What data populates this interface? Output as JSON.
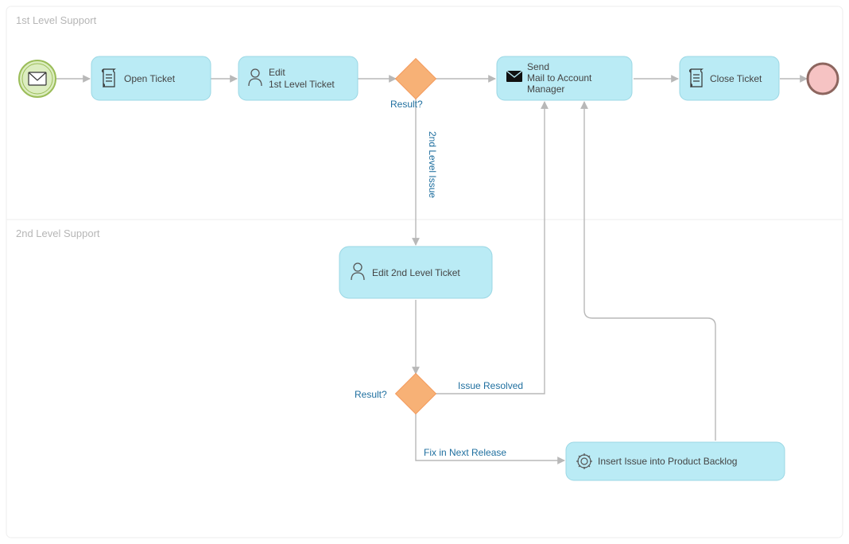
{
  "lanes": {
    "lane1": "1st Level Support",
    "lane2": "2nd Level Support"
  },
  "tasks": {
    "open_ticket": "Open Ticket",
    "edit1_line1": "Edit",
    "edit1_line2": "1st Level Ticket",
    "edit2": "Edit 2nd Level Ticket",
    "send1": "Send",
    "send2": "Mail to Account",
    "send3": "Manager",
    "close": "Close Ticket",
    "insert": "Insert Issue into Product Backlog"
  },
  "gateways": {
    "g1_label": "Result?",
    "g2_label": "Result?"
  },
  "flows": {
    "second_level": "2nd Level Issue",
    "issue_resolved": "Issue Resolved",
    "fix_next": "Fix in Next Release"
  },
  "chart_data": {
    "type": "bpmn",
    "lanes": [
      {
        "id": "L1",
        "name": "1st Level Support"
      },
      {
        "id": "L2",
        "name": "2nd Level Support"
      }
    ],
    "nodes": [
      {
        "id": "start",
        "type": "messageStartEvent",
        "lane": "L1",
        "label": ""
      },
      {
        "id": "t_open",
        "type": "scriptTask",
        "lane": "L1",
        "label": "Open Ticket"
      },
      {
        "id": "t_edit1",
        "type": "userTask",
        "lane": "L1",
        "label": "Edit 1st Level Ticket"
      },
      {
        "id": "g1",
        "type": "exclusiveGateway",
        "lane": "L1",
        "label": "Result?"
      },
      {
        "id": "t_send",
        "type": "sendTask",
        "lane": "L1",
        "label": "Send Mail to Account Manager"
      },
      {
        "id": "t_close",
        "type": "scriptTask",
        "lane": "L1",
        "label": "Close Ticket"
      },
      {
        "id": "end",
        "type": "endEvent",
        "lane": "L1",
        "label": ""
      },
      {
        "id": "t_edit2",
        "type": "userTask",
        "lane": "L2",
        "label": "Edit 2nd Level Ticket"
      },
      {
        "id": "g2",
        "type": "exclusiveGateway",
        "lane": "L2",
        "label": "Result?"
      },
      {
        "id": "t_insert",
        "type": "serviceTask",
        "lane": "L2",
        "label": "Insert Issue into Product Backlog"
      }
    ],
    "flows": [
      {
        "from": "start",
        "to": "t_open",
        "label": ""
      },
      {
        "from": "t_open",
        "to": "t_edit1",
        "label": ""
      },
      {
        "from": "t_edit1",
        "to": "g1",
        "label": ""
      },
      {
        "from": "g1",
        "to": "t_send",
        "label": ""
      },
      {
        "from": "g1",
        "to": "t_edit2",
        "label": "2nd Level Issue"
      },
      {
        "from": "t_send",
        "to": "t_close",
        "label": ""
      },
      {
        "from": "t_close",
        "to": "end",
        "label": ""
      },
      {
        "from": "t_edit2",
        "to": "g2",
        "label": ""
      },
      {
        "from": "g2",
        "to": "t_send",
        "label": "Issue Resolved"
      },
      {
        "from": "g2",
        "to": "t_insert",
        "label": "Fix in Next Release"
      },
      {
        "from": "t_insert",
        "to": "t_send",
        "label": ""
      }
    ]
  }
}
